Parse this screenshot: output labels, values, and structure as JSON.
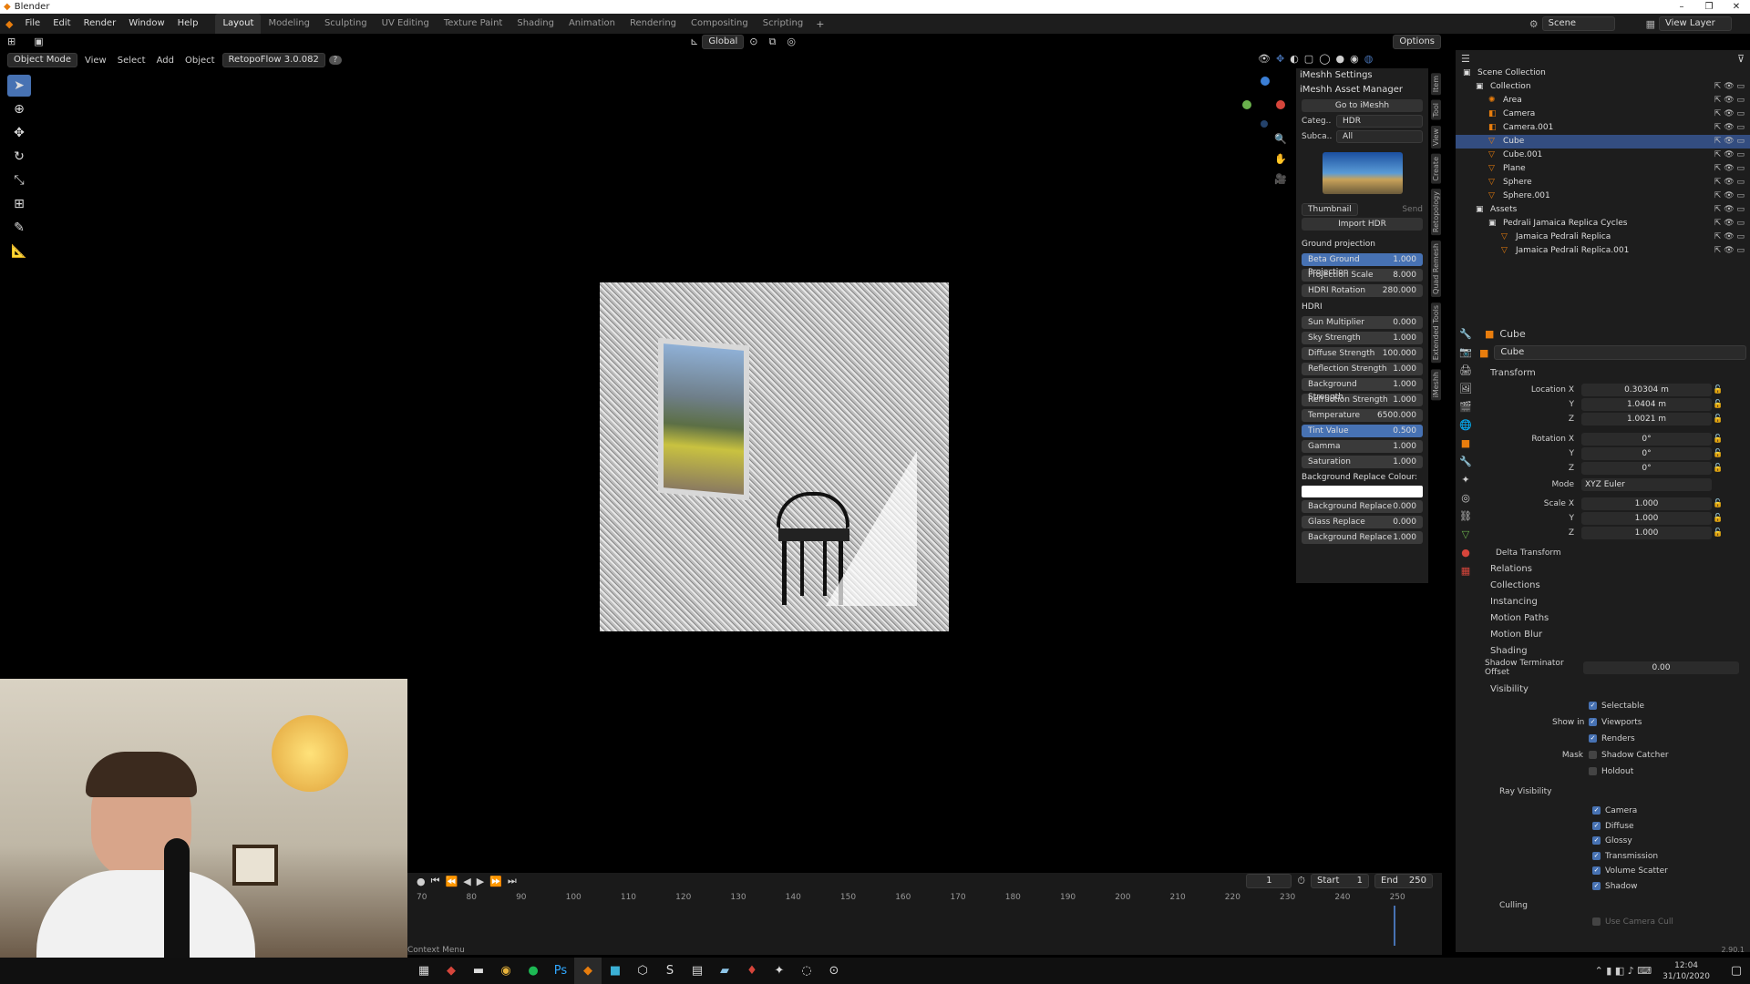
{
  "title": "Blender",
  "menu": [
    "File",
    "Edit",
    "Render",
    "Window",
    "Help"
  ],
  "workspaces": [
    "Layout",
    "Modeling",
    "Sculpting",
    "UV Editing",
    "Texture Paint",
    "Shading",
    "Animation",
    "Rendering",
    "Compositing",
    "Scripting"
  ],
  "scene_label": "Scene",
  "view_layer_label": "View Layer",
  "header3d": {
    "mode": "Object Mode",
    "view": "View",
    "select": "Select",
    "add": "Add",
    "object": "Object",
    "addon": "RetopoFlow 3.0.082",
    "orientation": "Global",
    "options": "Options"
  },
  "npanel": {
    "settings": "iMeshh Settings",
    "asset_manager": "iMeshh Asset Manager",
    "go_to": "Go to iMeshh",
    "category_label": "Categ..",
    "category_value": "HDR",
    "subcat_label": "Subca..",
    "subcat_value": "All",
    "thumbnail": "Thumbnail",
    "send": "Send",
    "import": "Import HDR",
    "ground_projection": "Ground projection",
    "ground_sliders": [
      {
        "label": "Beta Ground Projection",
        "value": "1.000",
        "hl": true
      },
      {
        "label": "Projection Scale",
        "value": "8.000",
        "hl": false
      },
      {
        "label": "HDRI Rotation",
        "value": "280.000",
        "hl": false
      }
    ],
    "hdri": "HDRI",
    "hdri_sliders": [
      {
        "label": "Sun Multiplier",
        "value": "0.000",
        "hl": false
      },
      {
        "label": "Sky Strength",
        "value": "1.000",
        "hl": false
      },
      {
        "label": "Diffuse Strength",
        "value": "100.000",
        "hl": false
      },
      {
        "label": "Reflection Strength",
        "value": "1.000",
        "hl": false
      },
      {
        "label": "Background Strength",
        "value": "1.000",
        "hl": false
      },
      {
        "label": "Refraction Strength",
        "value": "1.000",
        "hl": false
      },
      {
        "label": "Temperature",
        "value": "6500.000",
        "hl": false
      },
      {
        "label": "Tint Value",
        "value": "0.500",
        "hl": true
      },
      {
        "label": "Gamma",
        "value": "1.000",
        "hl": false
      },
      {
        "label": "Saturation",
        "value": "1.000",
        "hl": false
      }
    ],
    "bg_replace_colour": "Background Replace Colour:",
    "replace_sliders": [
      {
        "label": "Background Replace",
        "value": "0.000",
        "hl": false
      },
      {
        "label": "Glass Replace",
        "value": "0.000",
        "hl": false
      },
      {
        "label": "Background Replace",
        "value": "1.000",
        "hl": false
      }
    ],
    "tabs": [
      "Item",
      "Tool",
      "View",
      "Create",
      "Retopology",
      "Quad Remesh",
      "Extended Tools",
      "iMeshh"
    ]
  },
  "outliner": {
    "rows": [
      {
        "name": "Scene Collection",
        "indent": 0,
        "sel": false,
        "icon": "collection-icon"
      },
      {
        "name": "Collection",
        "indent": 1,
        "sel": false,
        "icon": "collection-icon"
      },
      {
        "name": "Area",
        "indent": 2,
        "sel": false,
        "icon": "light-icon"
      },
      {
        "name": "Camera",
        "indent": 2,
        "sel": false,
        "icon": "camera-icon"
      },
      {
        "name": "Camera.001",
        "indent": 2,
        "sel": false,
        "icon": "camera-icon"
      },
      {
        "name": "Cube",
        "indent": 2,
        "sel": true,
        "icon": "mesh-icon"
      },
      {
        "name": "Cube.001",
        "indent": 2,
        "sel": false,
        "icon": "mesh-icon"
      },
      {
        "name": "Plane",
        "indent": 2,
        "sel": false,
        "icon": "mesh-icon"
      },
      {
        "name": "Sphere",
        "indent": 2,
        "sel": false,
        "icon": "mesh-icon"
      },
      {
        "name": "Sphere.001",
        "indent": 2,
        "sel": false,
        "icon": "mesh-icon"
      },
      {
        "name": "Assets",
        "indent": 1,
        "sel": false,
        "icon": "collection-icon"
      },
      {
        "name": "Pedrali Jamaica Replica Cycles",
        "indent": 2,
        "sel": false,
        "icon": "collection-icon"
      },
      {
        "name": "Jamaica Pedrali Replica",
        "indent": 3,
        "sel": false,
        "icon": "mesh-icon"
      },
      {
        "name": "Jamaica Pedrali Replica.001",
        "indent": 3,
        "sel": false,
        "icon": "mesh-icon"
      }
    ]
  },
  "properties": {
    "object_name": "Cube",
    "data_name": "Cube",
    "transform": "Transform",
    "location_label": "Location X",
    "location": [
      "0.30304 m",
      "1.0404 m",
      "1.0021 m"
    ],
    "rotation_label": "Rotation X",
    "rotation": [
      "0°",
      "0°",
      "0°"
    ],
    "mode_label": "Mode",
    "mode_value": "XYZ Euler",
    "scale_label": "Scale X",
    "scale": [
      "1.000",
      "1.000",
      "1.000"
    ],
    "axis_y": "Y",
    "axis_z": "Z",
    "delta": "Delta Transform",
    "sections": [
      "Relations",
      "Collections",
      "Instancing",
      "Motion Paths",
      "Motion Blur",
      "Shading"
    ],
    "shadow_label": "Shadow Terminator Offset",
    "shadow_value": "0.00",
    "visibility": "Visibility",
    "selectable": "Selectable",
    "show_in": "Show in",
    "viewports": "Viewports",
    "renders": "Renders",
    "mask": "Mask",
    "shadow_catcher": "Shadow Catcher",
    "holdout": "Holdout",
    "ray_visibility": "Ray Visibility",
    "rays": [
      "Camera",
      "Diffuse",
      "Glossy",
      "Transmission",
      "Volume Scatter",
      "Shadow"
    ],
    "culling": "Culling",
    "use_camera_cull": "Use Camera Cull",
    "version": "2.90.1"
  },
  "timeline": {
    "frame": "1",
    "start_label": "Start",
    "start": "1",
    "end_label": "End",
    "end": "250",
    "ticks": [
      "70",
      "80",
      "90",
      "100",
      "110",
      "120",
      "130",
      "140",
      "150",
      "160",
      "170",
      "180",
      "190",
      "200",
      "210",
      "220",
      "230",
      "240",
      "250"
    ],
    "status": "Context Menu"
  },
  "taskbar": {
    "time": "12:04",
    "date": "31/10/2020"
  }
}
